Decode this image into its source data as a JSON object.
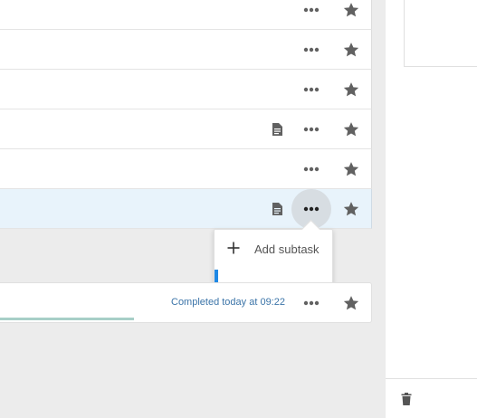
{
  "colors": {
    "background": "#ececec",
    "selected_row": "#e8f3fb",
    "icon_gray": "#616161",
    "completed_text": "#3b74a8",
    "accent_blue": "#1e88e5",
    "progress": "#a7cfc7"
  },
  "tasks": [
    {
      "icons": [
        "more-dots-icon",
        "star-icon"
      ]
    },
    {
      "icons": [
        "more-dots-icon",
        "star-icon"
      ]
    },
    {
      "icons": [
        "more-dots-icon",
        "star-icon"
      ]
    },
    {
      "icons": [
        "note-icon",
        "more-dots-icon",
        "star-icon"
      ]
    },
    {
      "icons": [
        "more-dots-icon",
        "star-icon"
      ]
    },
    {
      "icons": [
        "note-icon",
        "more-dots-icon",
        "star-icon"
      ],
      "selected": true
    }
  ],
  "context_menu": {
    "items": [
      {
        "icon": "plus-icon",
        "label": "Add subtask"
      }
    ]
  },
  "completed_task": {
    "status": "Completed today at 09:22"
  },
  "detail_panel": {
    "icons": [
      "trash-icon"
    ]
  }
}
